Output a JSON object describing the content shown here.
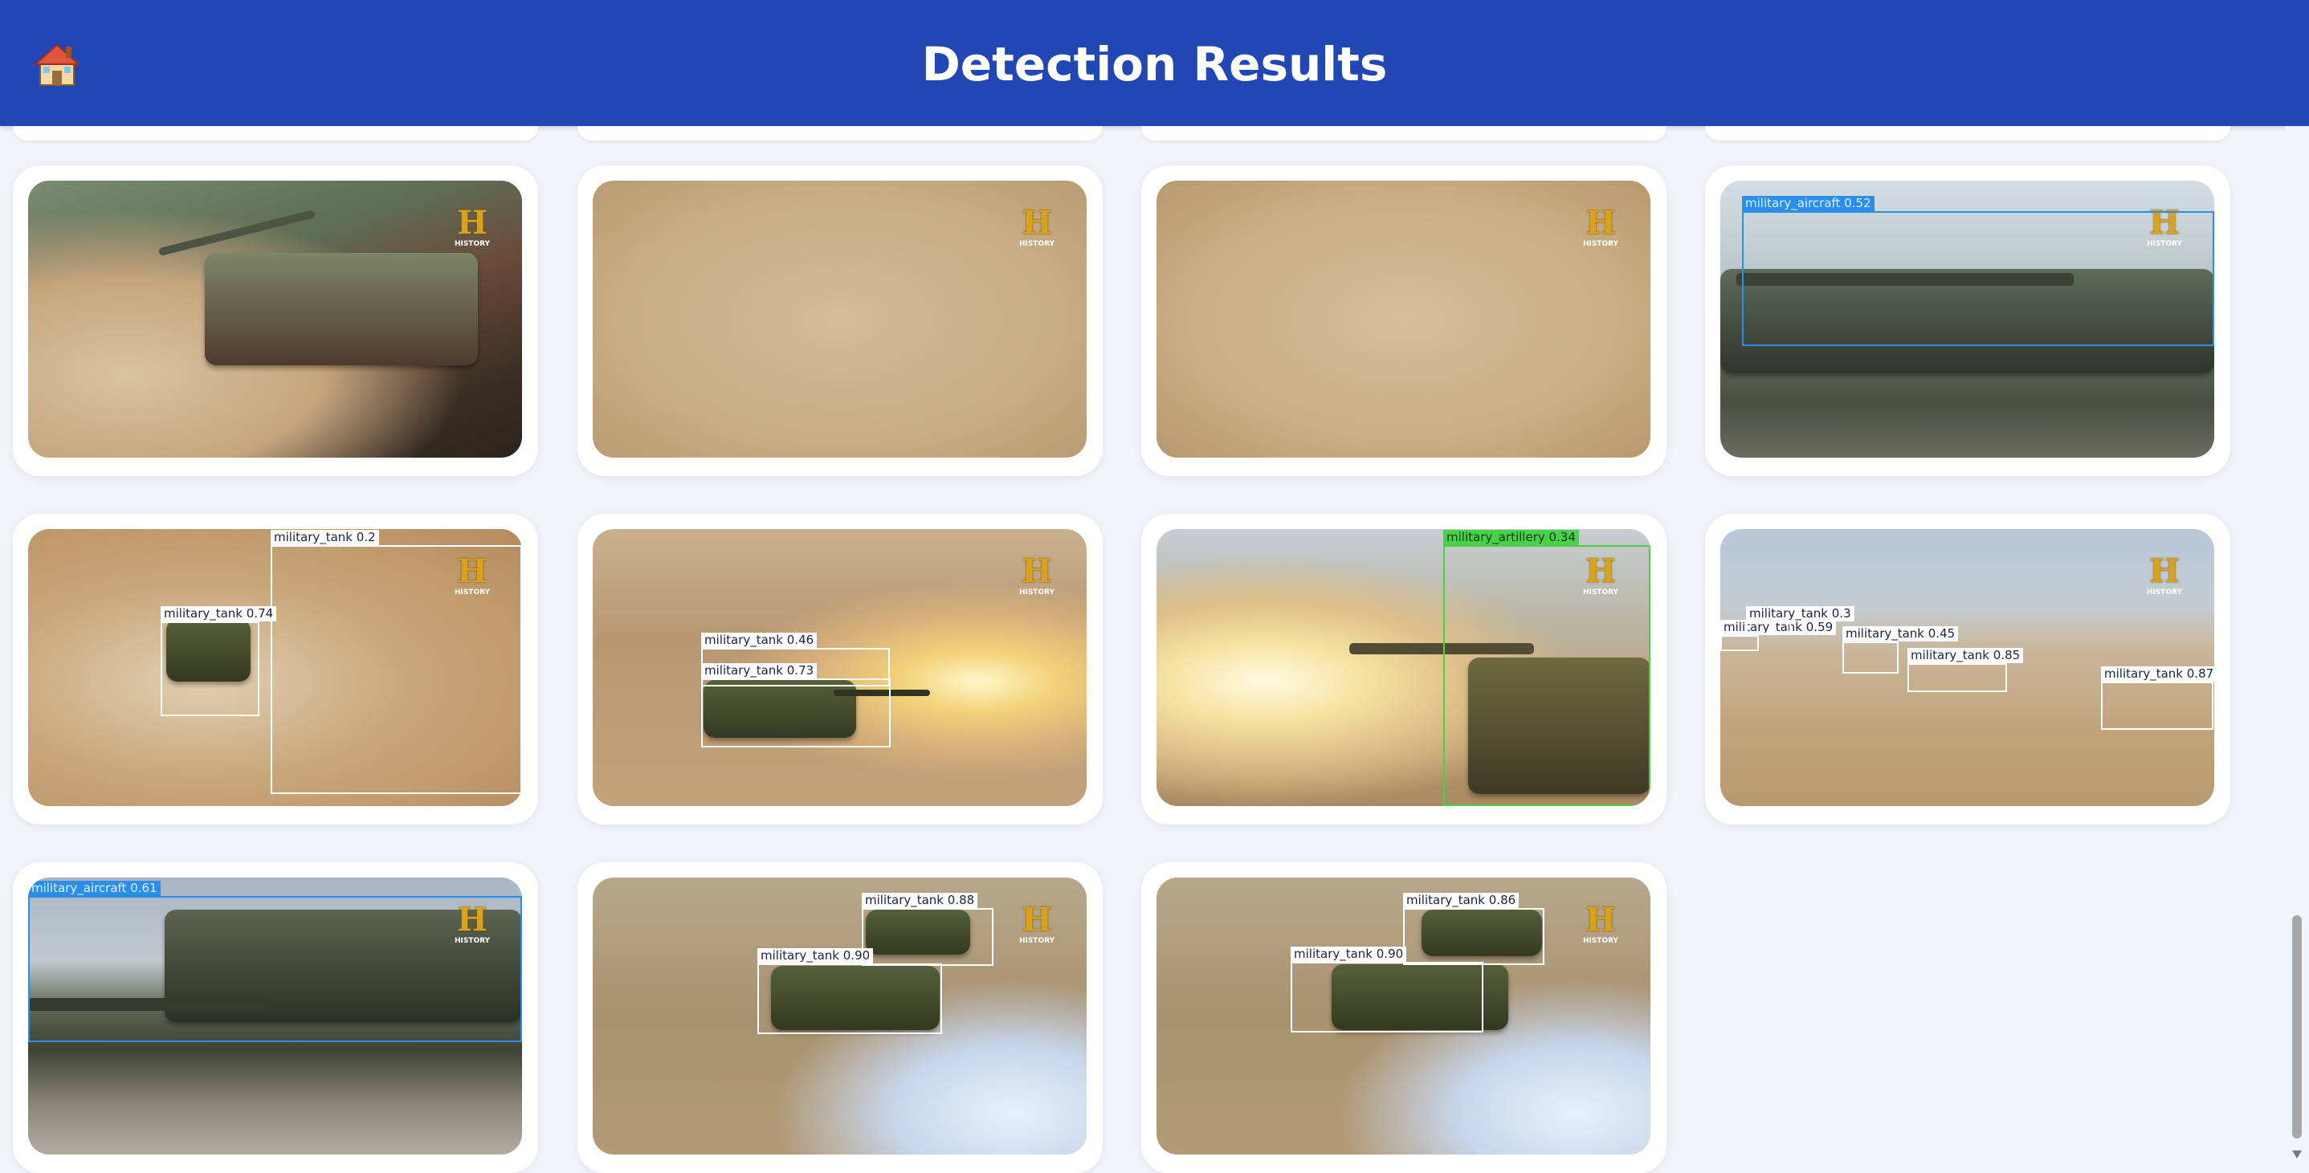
{
  "header": {
    "title": "Detection Results",
    "home_icon": "house-emoji-icon",
    "color": "#2147b5"
  },
  "watermark": {
    "letter": "H",
    "text": "HISTORY"
  },
  "results": [
    {
      "detections": []
    },
    {
      "detections": []
    },
    {
      "detections": []
    },
    {
      "detections": [
        {
          "label": "military_aircraft 0.52",
          "color": "#2b8ee8"
        }
      ]
    },
    {
      "detections": [
        {
          "label": "military_tank 0.74"
        },
        {
          "label": "military_tank 0.2"
        }
      ]
    },
    {
      "detections": [
        {
          "label": "military_tank 0.46"
        },
        {
          "label": "military_tank 0.73"
        }
      ]
    },
    {
      "detections": [
        {
          "label": "military_artillery 0.34",
          "color": "#4ad14a"
        }
      ]
    },
    {
      "detections": [
        {
          "label": "military_tank 0.59"
        },
        {
          "label": "military_tank 0.3"
        },
        {
          "label": "military_tank 0.45"
        },
        {
          "label": "military_tank 0.85"
        },
        {
          "label": "military_tank 0.87"
        }
      ]
    },
    {
      "detections": [
        {
          "label": "military_aircraft 0.61",
          "color": "#2b8ee8"
        }
      ]
    },
    {
      "detections": [
        {
          "label": "military_tank 0.88"
        },
        {
          "label": "military_tank 0.90"
        }
      ]
    },
    {
      "detections": [
        {
          "label": "military_tank 0.86"
        },
        {
          "label": "military_tank 0.90"
        }
      ]
    }
  ]
}
